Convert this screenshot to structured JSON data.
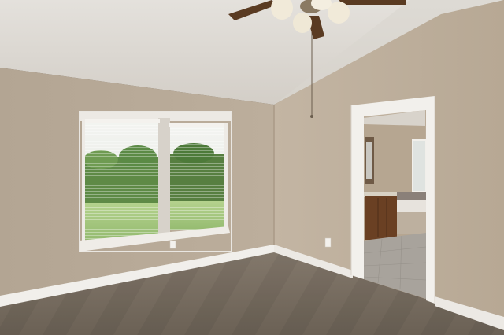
{
  "scene": {
    "kind": "photo",
    "subject": "empty-bedroom-interior",
    "elements": [
      "vaulted-ceiling",
      "ceiling-fan",
      "double-window-with-blinds",
      "doorway-to-bathroom",
      "carpet-floor",
      "baseboards",
      "electrical-outlets"
    ]
  },
  "palette": {
    "ceiling": "#dedbd6",
    "ceiling_shadow": "#cfcac3",
    "wall_left": "#b8aa98",
    "wall_right": "#c0b19f",
    "trim": "#f2f0ec",
    "carpet": "#7b7064",
    "carpet_dark": "#5f564b",
    "window_light": "#e9ece6",
    "lawn": "#9fc37a",
    "hedge": "#4f7a3a",
    "cabinet": "#6a4023",
    "bath_tile": "#a7a39c",
    "bath_wall": "#b9a994"
  }
}
